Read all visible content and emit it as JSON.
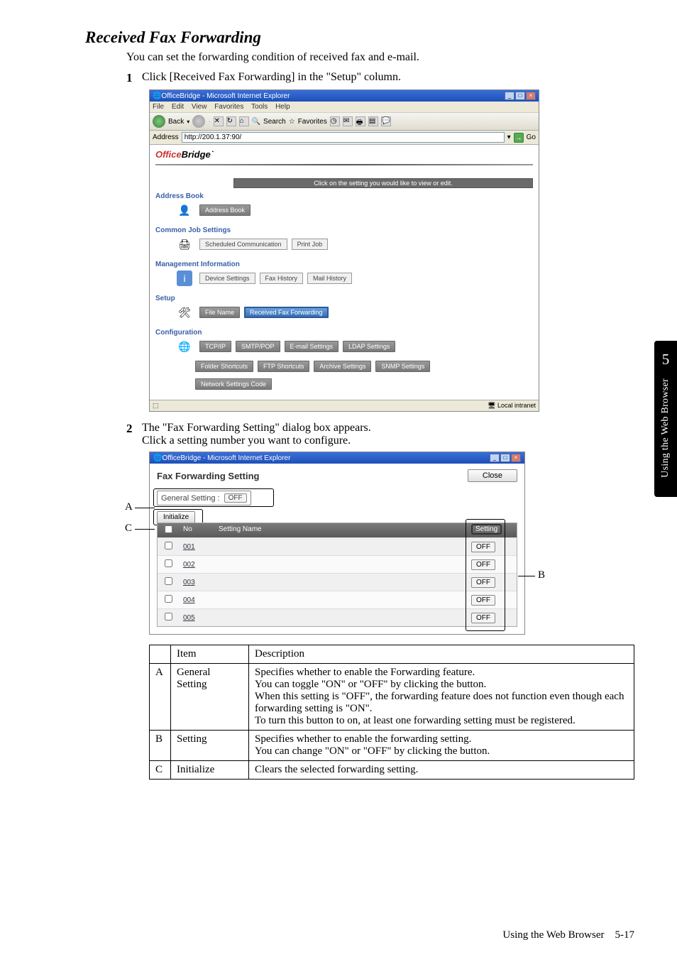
{
  "section_title": "Received Fax Forwarding",
  "intro": "You can set the forwarding condition of received fax and e-mail.",
  "steps": {
    "s1": {
      "num": "1",
      "text": "Click [Received Fax Forwarding] in the \"Setup\" column."
    },
    "s2": {
      "num": "2",
      "line1": "The \"Fax Forwarding Setting\" dialog box appears.",
      "line2": "Click a setting number you want to configure."
    }
  },
  "ie": {
    "title": "OfficeBridge - Microsoft Internet Explorer",
    "menu": {
      "file": "File",
      "edit": "Edit",
      "view": "View",
      "favorites": "Favorites",
      "tools": "Tools",
      "help": "Help"
    },
    "toolbar": {
      "back": "Back",
      "search": "Search",
      "favorites": "Favorites"
    },
    "address_label": "Address",
    "address_value": "http://200.1.37:90/",
    "go": "Go",
    "status_zone": "Local intranet"
  },
  "ob": {
    "logo_left": "Office",
    "logo_right": "Bridge",
    "banner": "Click on the setting you would like to view or edit.",
    "sections": {
      "address_book": {
        "label": "Address Book",
        "btn": "Address Book"
      },
      "common": {
        "label": "Common Job Settings",
        "b1": "Scheduled Communication",
        "b2": "Print Job"
      },
      "mgmt": {
        "label": "Management Information",
        "b1": "Device Settings",
        "b2": "Fax History",
        "b3": "Mail History"
      },
      "setup": {
        "label": "Setup",
        "b1": "File Name",
        "b2": "Received Fax Forwarding"
      },
      "config": {
        "label": "Configuration",
        "r1": {
          "b1": "TCP/IP",
          "b2": "SMTP/POP",
          "b3": "E-mail Settings",
          "b4": "LDAP Settings"
        },
        "r2": {
          "b1": "Folder Shortcuts",
          "b2": "FTP Shortcuts",
          "b3": "Archive Settings",
          "b4": "SNMP Settings"
        },
        "r3": {
          "b1": "Network Settings Code"
        }
      }
    }
  },
  "dialog": {
    "title": "OfficeBridge - Microsoft Internet Explorer",
    "header": "Fax Forwarding Setting",
    "close": "Close",
    "general_label": "General Setting :",
    "general_value": "OFF",
    "initialize": "Initialize",
    "cols": {
      "no": "No",
      "name": "Setting Name",
      "setting": "Setting"
    },
    "rows": [
      {
        "no": "001",
        "setting": "OFF"
      },
      {
        "no": "002",
        "setting": "OFF"
      },
      {
        "no": "003",
        "setting": "OFF"
      },
      {
        "no": "004",
        "setting": "OFF"
      },
      {
        "no": "005",
        "setting": "OFF"
      }
    ]
  },
  "callouts": {
    "A": "A",
    "B": "B",
    "C": "C"
  },
  "table": {
    "h_item": "Item",
    "h_desc": "Description",
    "rowA": {
      "key": "A",
      "item": "General Setting",
      "desc": "Specifies whether to enable the Forwarding feature.\nYou can toggle \"ON\" or \"OFF\" by clicking the button.\nWhen this setting is \"OFF\", the forwarding feature does not function even though each forwarding setting is \"ON\".\nTo turn this button to on, at least one forwarding setting must be registered."
    },
    "rowB": {
      "key": "B",
      "item": "Setting",
      "desc": "Specifies whether to enable the forwarding setting.\nYou can change \"ON\" or \"OFF\" by clicking the button."
    },
    "rowC": {
      "key": "C",
      "item": "Initialize",
      "desc": "Clears the selected forwarding setting."
    }
  },
  "side": {
    "chapter": "5",
    "label": "Using the Web Browser"
  },
  "footer": {
    "label": "Using the Web Browser",
    "page": "5-17"
  }
}
